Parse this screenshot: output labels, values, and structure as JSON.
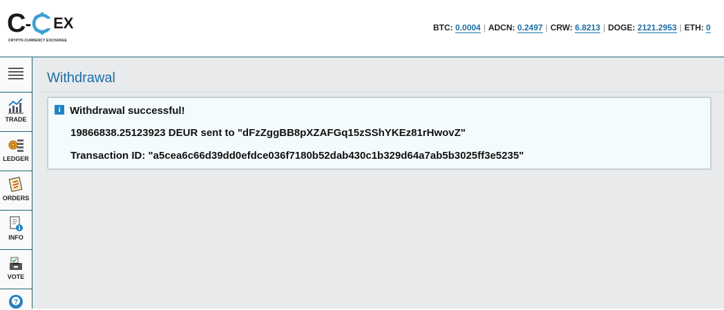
{
  "brand": {
    "logo_c": "C",
    "logo_dash": "-",
    "logo_ex": "EX",
    "tagline": "CRYPTO-CURRENCY EXCHANGE",
    "accent_color": "#1c6fa5",
    "border_color": "#1d6470"
  },
  "ticker": [
    {
      "symbol": "BTC:",
      "value": "0.0004"
    },
    {
      "symbol": "ADCN:",
      "value": "0.2497"
    },
    {
      "symbol": "CRW:",
      "value": "6.8213"
    },
    {
      "symbol": "DOGE:",
      "value": "2121.2953"
    },
    {
      "symbol": "ETH:",
      "value": "0"
    }
  ],
  "sidebar": {
    "items": [
      {
        "label": "",
        "icon": "menu-icon"
      },
      {
        "label": "TRADE",
        "icon": "chart-icon"
      },
      {
        "label": "LEDGER",
        "icon": "coins-icon"
      },
      {
        "label": "ORDERS",
        "icon": "orders-icon"
      },
      {
        "label": "INFO",
        "icon": "info-doc-icon"
      },
      {
        "label": "VOTE",
        "icon": "vote-icon"
      },
      {
        "label": "",
        "icon": "help-icon"
      }
    ]
  },
  "page": {
    "title": "Withdrawal"
  },
  "alert": {
    "icon": "i",
    "title": "Withdrawal successful!",
    "sent_line": "19866838.25123923 DEUR sent to \"dFzZggBB8pXZAFGq15zSShYKEz81rHwovZ\"",
    "txid_line": "Transaction ID: \"a5cea6c66d39dd0efdce036f7180b52dab430c1b329d64a7ab5b3025ff3e5235\""
  }
}
